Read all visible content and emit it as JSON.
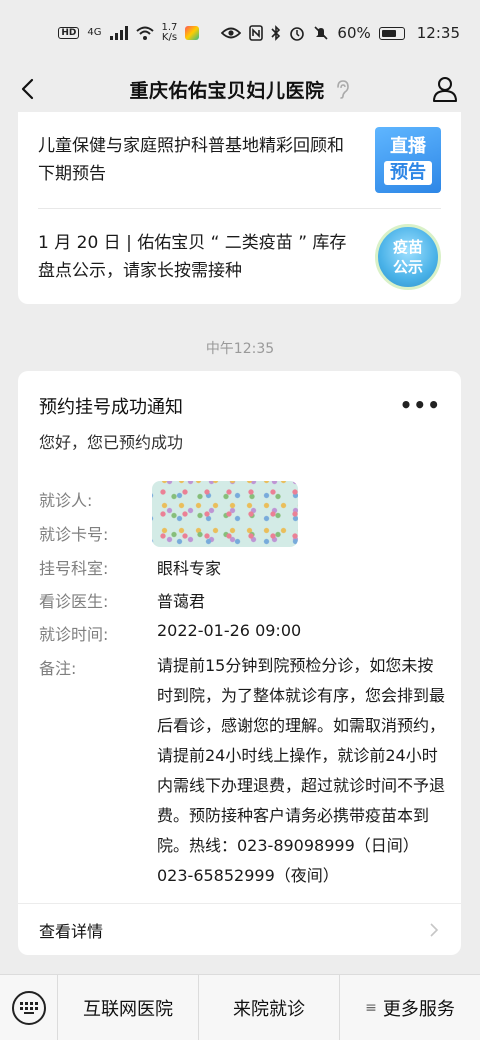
{
  "status_bar": {
    "hd": "HD",
    "network_type": "4G",
    "speed_value": "1.7",
    "speed_unit": "K/s",
    "battery_percent": "60%",
    "time": "12:35"
  },
  "nav": {
    "title": "重庆佑佑宝贝妇儿医院"
  },
  "articles": [
    {
      "text": "儿童保健与家庭照护科普基地精彩回顾和下期预告",
      "thumb_line1": "直播",
      "thumb_line2": "预告"
    },
    {
      "text": "1 月 20 日 | 佑佑宝贝 “ 二类疫苗 ” 库存盘点公示，请家长按需接种",
      "thumb_line1": "疫苗",
      "thumb_line2": "公示"
    }
  ],
  "timestamp": "中午12:35",
  "notice": {
    "title": "预约挂号成功通知",
    "more": "•••",
    "subtitle": "您好，您已预约成功",
    "fields": {
      "patient_label": "就诊人:",
      "card_label": "就诊卡号:",
      "dept_label": "挂号科室:",
      "dept_value": "眼科专家",
      "doctor_label": "看诊医生:",
      "doctor_value": "普蔼君",
      "time_label": "就诊时间:",
      "time_value": "2022-01-26 09:00",
      "remark_label": "备注:",
      "remark_value": "请提前15分钟到院预检分诊，如您未按时到院，为了整体就诊有序，您会排到最后看诊，感谢您的理解。如需取消预约，请提前24小时线上操作，就诊前24小时内需线下办理退费，超过就诊时间不予退费。预防接种客户请务必携带疫苗本到院。热线：023-89098999（日间）023-65852999（夜间）"
    },
    "detail_label": "查看详情"
  },
  "bottom_menu": {
    "items": [
      "互联网医院",
      "来院就诊",
      "更多服务"
    ],
    "more_glyph": "≡"
  },
  "colors": {
    "background": "#ededed",
    "card": "#ffffff",
    "label_gray": "#7f7f7f"
  }
}
